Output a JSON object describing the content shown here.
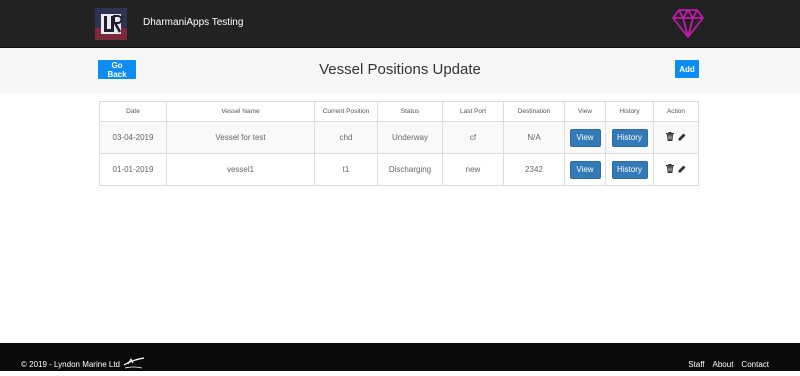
{
  "header": {
    "brand": "DharmaniApps Testing",
    "accent_color": "#c11aa8"
  },
  "subheader": {
    "go_back_label": "Go Back",
    "title": "Vessel Positions Update",
    "add_label": "Add"
  },
  "table": {
    "columns": [
      "Date",
      "Vessel Name",
      "Current Position",
      "Status",
      "Last Port",
      "Destination",
      "View",
      "History",
      "Action"
    ],
    "rows": [
      {
        "date": "03-04-2019",
        "vessel": "Vessel for test",
        "position": "chd",
        "status": "Underway",
        "last_port": "cf",
        "destination": "N/A",
        "view_label": "View",
        "history_label": "History"
      },
      {
        "date": "01-01-2019",
        "vessel": "vessel1",
        "position": "t1",
        "status": "Discharging",
        "last_port": "new",
        "destination": "2342",
        "view_label": "View",
        "history_label": "History"
      }
    ]
  },
  "footer": {
    "copyright": "© 2019 - Lyndon Marine Ltd",
    "links": [
      "Staff",
      "About",
      "Contact"
    ]
  },
  "icons": {
    "delete": "trash-icon",
    "edit": "pencil-icon",
    "brand": "diamond-icon"
  }
}
